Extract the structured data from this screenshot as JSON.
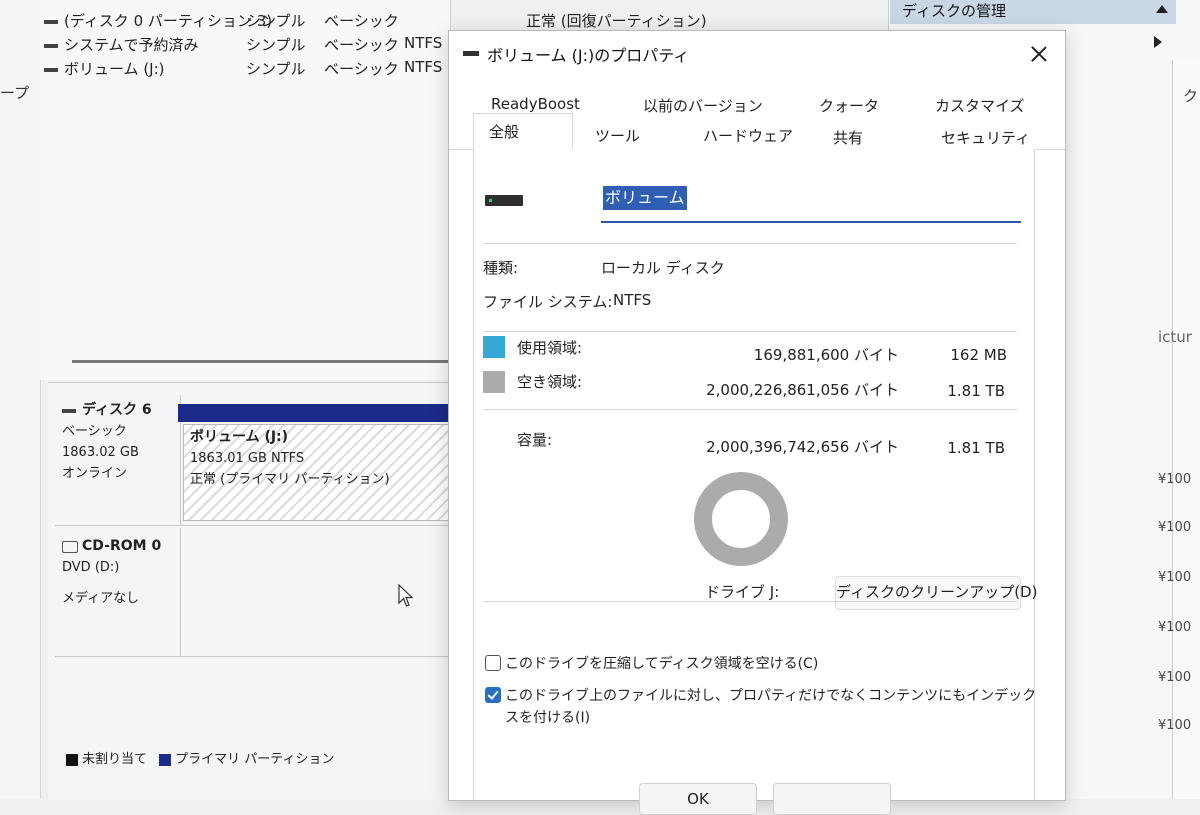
{
  "background_window": {
    "left_strip_text": "ープ",
    "volume_rows": [
      {
        "name": "(ディスク 0 パーティション 3)",
        "layout": "シンプル",
        "type": "ベーシック",
        "fs": "",
        "status": "正常 (回復パーティション)"
      },
      {
        "name": "システムで予約済み",
        "layout": "シンプル",
        "type": "ベーシック",
        "fs": "NTFS",
        "status": ""
      },
      {
        "name": "ボリューム (J:)",
        "layout": "シンプル",
        "type": "ベーシック",
        "fs": "NTFS",
        "status": ""
      }
    ],
    "disk6": {
      "title": "ディスク 6",
      "type": "ベーシック",
      "size": "1863.02 GB",
      "state": "オンライン"
    },
    "partition": {
      "title": "ボリューム  (J:)",
      "size_fs": "1863.01 GB NTFS",
      "status": "正常 (プライマリ パーティション)"
    },
    "cdrom": {
      "title": "CD-ROM 0",
      "drive": "DVD (D:)",
      "media": "メディアなし"
    },
    "legend": {
      "unallocated": "未割り当て",
      "primary": "プライマリ パーティション"
    },
    "actions_header": "ディスクの管理",
    "right_fragments": {
      "top": "ク",
      "ictur": "ictur",
      "prices": [
        "¥100",
        "¥100",
        "¥100",
        "¥100",
        "¥100",
        "¥100"
      ]
    }
  },
  "dialog": {
    "title": "ボリューム (J:)のプロパティ",
    "tabs_row1": [
      "ReadyBoost",
      "以前のバージョン",
      "クォータ",
      "カスタマイズ"
    ],
    "tabs_row2": [
      "全般",
      "ツール",
      "ハードウェア",
      "共有",
      "セキュリティ"
    ],
    "volume_name": "ボリューム",
    "type_label": "種類:",
    "type_value": "ローカル ディスク",
    "fs_label": "ファイル システム:",
    "fs_value": "NTFS",
    "used_label": "使用領域:",
    "used_bytes": "169,881,600 バイト",
    "used_size": "162 MB",
    "free_label": "空き領域:",
    "free_bytes": "2,000,226,861,056 バイト",
    "free_size": "1.81 TB",
    "capacity_label": "容量:",
    "capacity_bytes": "2,000,396,742,656 バイト",
    "capacity_size": "1.81 TB",
    "used_fraction": 8.49e-05,
    "drive_label": "ドライブ J:",
    "cleanup_button": "ディスクのクリーンアップ(D)",
    "compress_label": "このドライブを圧縮してディスク領域を空ける(C)",
    "compress_checked": false,
    "index_label_line1": "このドライブ上のファイルに対し、プロパティだけでなくコンテンツにもインデック",
    "index_label_line2": "スを付ける(I)",
    "index_checked": true,
    "ok_button": "OK",
    "colors": {
      "used": "#35a9d6",
      "free": "#a9abad",
      "accent": "#2a56a8"
    }
  }
}
